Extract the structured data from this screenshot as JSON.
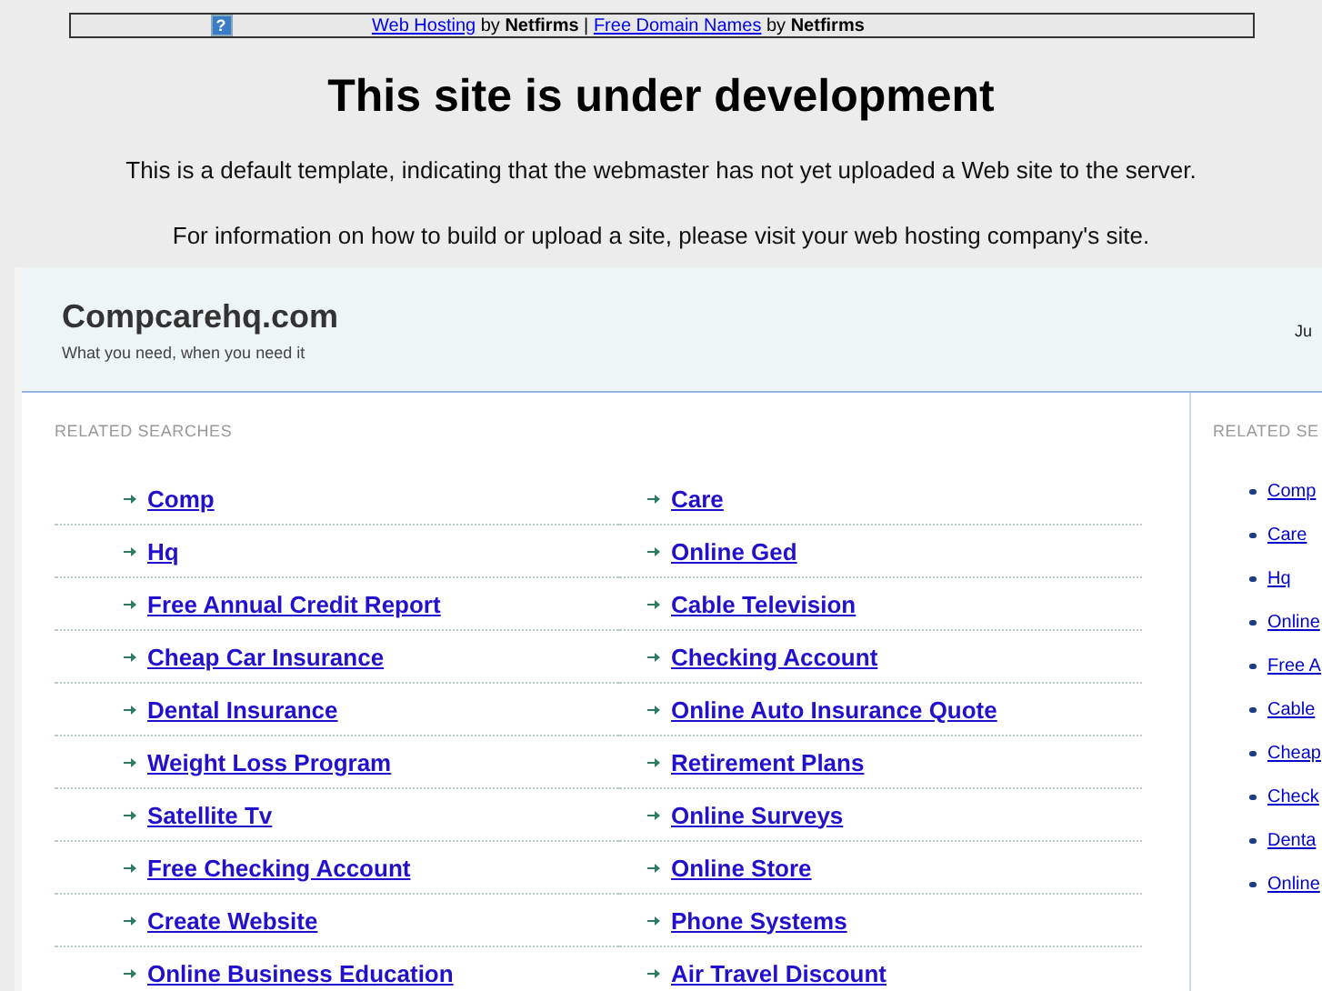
{
  "top_bar": {
    "help_icon": "?",
    "links": [
      {
        "text": "Web Hosting",
        "by": "by",
        "brand": "Netfirms"
      },
      {
        "text": "Free Domain Names",
        "by": "by",
        "brand": "Netfirms"
      }
    ],
    "separator": "|"
  },
  "heading": "This site is under development",
  "paragraphs": [
    "This is a default template, indicating that the webmaster has not yet uploaded a Web site to the server.",
    "For information on how to build or upload a site, please visit your web hosting company's site."
  ],
  "site": {
    "title": "Compcarehq.com",
    "tagline": "What you need, when you need it",
    "header_right": "Ju"
  },
  "related": {
    "label": "RELATED SEARCHES",
    "columns": [
      [
        "Comp",
        "Hq",
        "Free Annual Credit Report",
        "Cheap Car Insurance",
        "Dental Insurance",
        "Weight Loss Program",
        "Satellite Tv",
        "Free Checking Account",
        "Create Website",
        "Online Business Education"
      ],
      [
        "Care",
        "Online Ged",
        "Cable Television",
        "Checking Account",
        "Online Auto Insurance Quote",
        "Retirement Plans",
        "Online Surveys",
        "Online Store",
        "Phone Systems",
        "Air Travel Discount"
      ]
    ]
  },
  "side": {
    "label": "RELATED SE",
    "links": [
      "Comp",
      "Care",
      "Hq",
      "Online",
      "Free A",
      "Cable",
      "Cheap",
      "Check",
      "Denta",
      "Online"
    ]
  }
}
